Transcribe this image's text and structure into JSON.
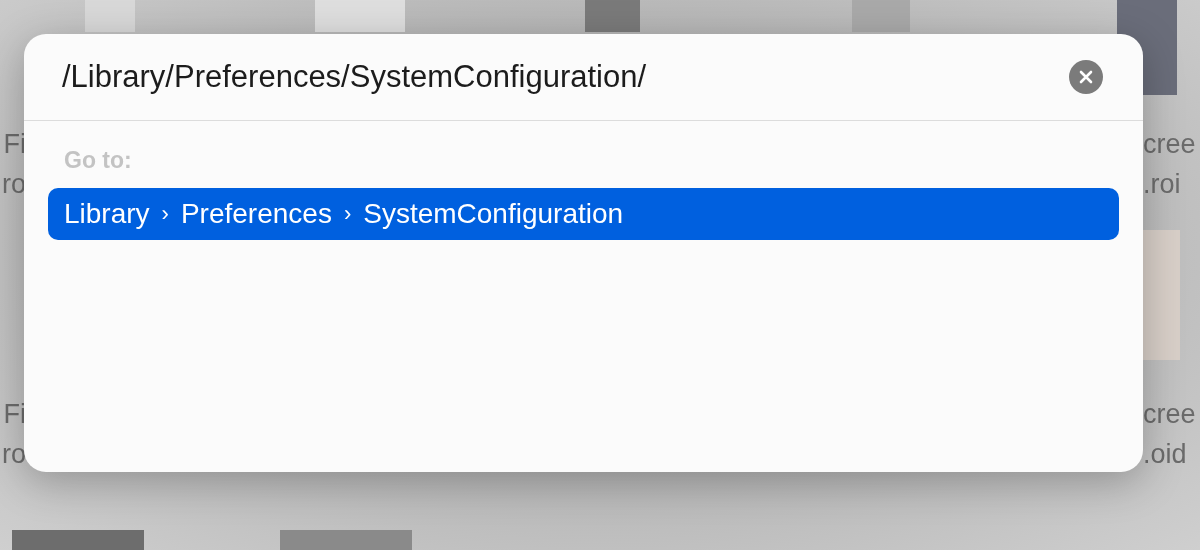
{
  "background_files": {
    "left_labels": [
      {
        "line_1": "Fi",
        "line_2": "ro"
      },
      {
        "line_1": "Fi",
        "line_2": "ro"
      }
    ],
    "right_labels": [
      {
        "line_1": "cree",
        "line_2": ".roi"
      },
      {
        "line_1": "cree",
        "line_2": ".oid"
      }
    ]
  },
  "dialog": {
    "path_field": {
      "value": "/Library/Preferences/SystemConfiguration/"
    },
    "section_label": "Go to:",
    "results": [
      {
        "segments": [
          "Library",
          "Preferences",
          "SystemConfiguration"
        ],
        "separator": "›",
        "selected": true
      }
    ]
  }
}
